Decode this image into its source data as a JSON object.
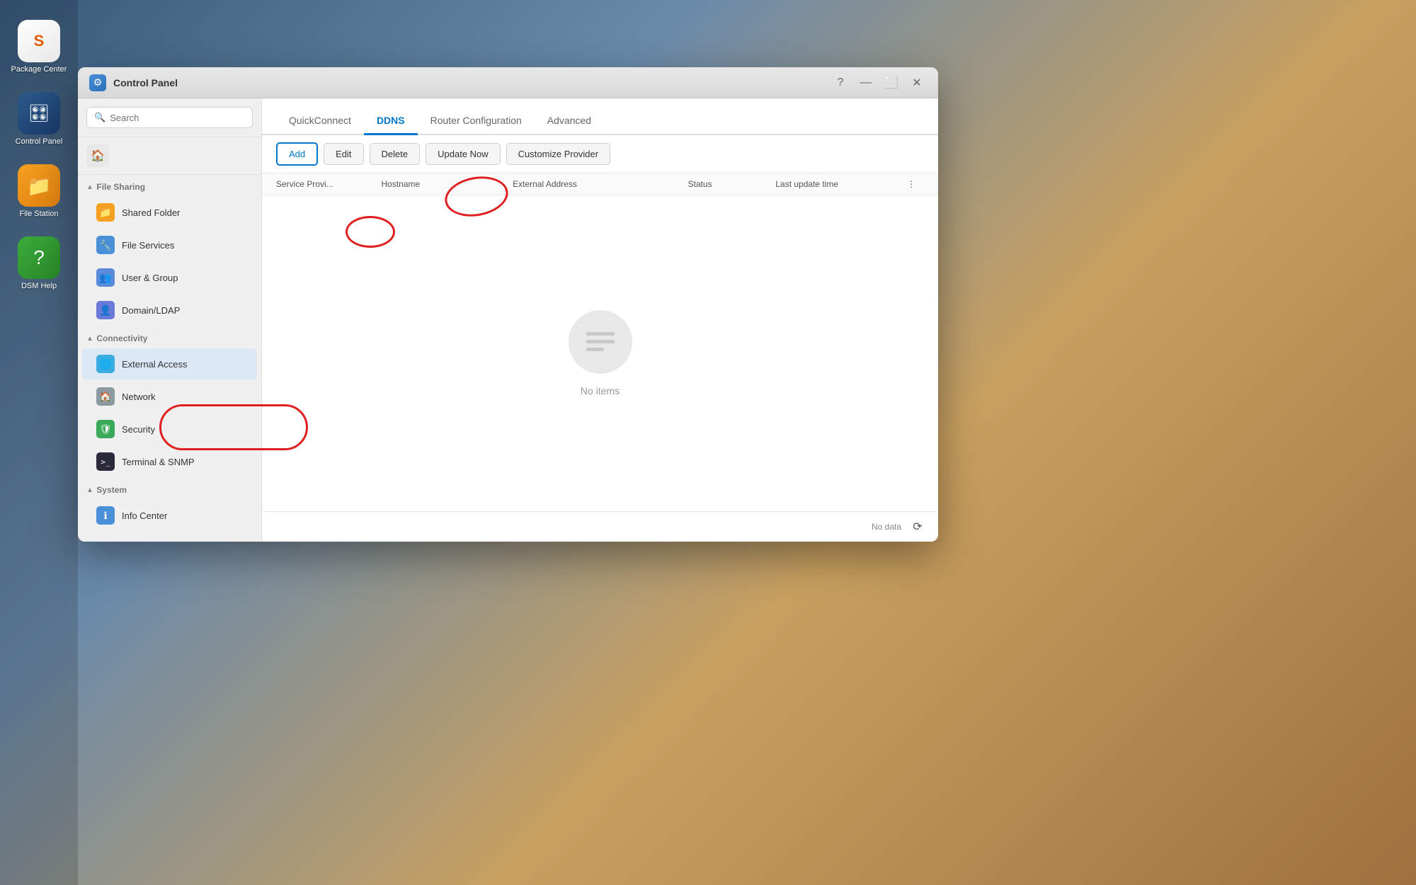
{
  "desktop": {
    "dock": [
      {
        "id": "package-center",
        "label": "Package\nCenter",
        "icon": "S",
        "iconClass": "icon-synology"
      },
      {
        "id": "control-panel",
        "label": "Control Panel",
        "icon": "🎛",
        "iconClass": "icon-mixer"
      },
      {
        "id": "file-station",
        "label": "File Station",
        "icon": "📁",
        "iconClass": "icon-folder"
      },
      {
        "id": "dsm-help",
        "label": "DSM Help",
        "icon": "?",
        "iconClass": "icon-help"
      }
    ]
  },
  "window": {
    "title": "Control Panel",
    "titlebar_icon": "⚙"
  },
  "sidebar": {
    "search_placeholder": "Search",
    "sections": [
      {
        "id": "file-sharing",
        "label": "File Sharing",
        "expanded": true,
        "items": [
          {
            "id": "shared-folder",
            "label": "Shared Folder",
            "iconClass": "icon-shared-folder",
            "icon": "📁"
          },
          {
            "id": "file-services",
            "label": "File Services",
            "iconClass": "icon-file-services",
            "icon": "🔧"
          },
          {
            "id": "user-group",
            "label": "User & Group",
            "iconClass": "icon-user-group",
            "icon": "👥"
          },
          {
            "id": "domain-ldap",
            "label": "Domain/LDAP",
            "iconClass": "icon-domain",
            "icon": "👤"
          }
        ]
      },
      {
        "id": "connectivity",
        "label": "Connectivity",
        "expanded": true,
        "items": [
          {
            "id": "external-access",
            "label": "External Access",
            "iconClass": "icon-external",
            "icon": "🌐",
            "active": true
          },
          {
            "id": "network",
            "label": "Network",
            "iconClass": "icon-network",
            "icon": "🏠"
          },
          {
            "id": "security",
            "label": "Security",
            "iconClass": "icon-security",
            "icon": "🛡"
          },
          {
            "id": "terminal-snmp",
            "label": "Terminal & SNMP",
            "iconClass": "icon-terminal",
            "icon": ">"
          }
        ]
      },
      {
        "id": "system",
        "label": "System",
        "expanded": true,
        "items": [
          {
            "id": "info-center",
            "label": "Info Center",
            "iconClass": "icon-info",
            "icon": "ℹ"
          }
        ]
      }
    ]
  },
  "tabs": [
    {
      "id": "quickconnect",
      "label": "QuickConnect",
      "active": false
    },
    {
      "id": "ddns",
      "label": "DDNS",
      "active": true
    },
    {
      "id": "router-configuration",
      "label": "Router Configuration",
      "active": false
    },
    {
      "id": "advanced",
      "label": "Advanced",
      "active": false
    }
  ],
  "toolbar": {
    "add_label": "Add",
    "edit_label": "Edit",
    "delete_label": "Delete",
    "update_now_label": "Update Now",
    "customize_provider_label": "Customize Provider"
  },
  "table": {
    "columns": [
      {
        "id": "service-provider",
        "label": "Service Provi..."
      },
      {
        "id": "hostname",
        "label": "Hostname"
      },
      {
        "id": "external-address",
        "label": "External Address"
      },
      {
        "id": "status",
        "label": "Status"
      },
      {
        "id": "last-update-time",
        "label": "Last update time"
      }
    ],
    "empty_message": "No items"
  },
  "footer": {
    "no_data_label": "No data",
    "refresh_icon": "⟳"
  }
}
